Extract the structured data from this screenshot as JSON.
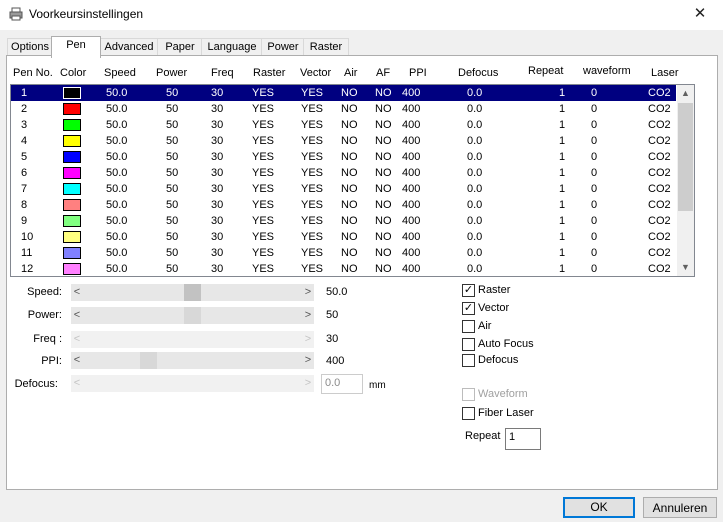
{
  "window": {
    "title": "Voorkeursinstellingen",
    "close_glyph": "✕"
  },
  "tabs": [
    "Options",
    "Pen",
    "Advanced",
    "Paper",
    "Language",
    "Power",
    "Raster"
  ],
  "active_tab": "Pen",
  "columns": [
    "Pen No.",
    "Color",
    "Speed",
    "Power",
    "Freq",
    "Raster",
    "Vector",
    "Air",
    "AF",
    "PPI",
    "Defocus",
    "Repeat",
    "waveform",
    "Laser"
  ],
  "pens": [
    {
      "no": "1",
      "color": "#000000",
      "speed": "50.0",
      "power": "50",
      "freq": "30",
      "raster": "YES",
      "vector": "YES",
      "air": "NO",
      "af": "NO",
      "ppi": "400",
      "defocus": "0.0",
      "repeat": "1",
      "waveform": "0",
      "laser": "CO2"
    },
    {
      "no": "2",
      "color": "#ff0000",
      "speed": "50.0",
      "power": "50",
      "freq": "30",
      "raster": "YES",
      "vector": "YES",
      "air": "NO",
      "af": "NO",
      "ppi": "400",
      "defocus": "0.0",
      "repeat": "1",
      "waveform": "0",
      "laser": "CO2"
    },
    {
      "no": "3",
      "color": "#00ff00",
      "speed": "50.0",
      "power": "50",
      "freq": "30",
      "raster": "YES",
      "vector": "YES",
      "air": "NO",
      "af": "NO",
      "ppi": "400",
      "defocus": "0.0",
      "repeat": "1",
      "waveform": "0",
      "laser": "CO2"
    },
    {
      "no": "4",
      "color": "#ffff00",
      "speed": "50.0",
      "power": "50",
      "freq": "30",
      "raster": "YES",
      "vector": "YES",
      "air": "NO",
      "af": "NO",
      "ppi": "400",
      "defocus": "0.0",
      "repeat": "1",
      "waveform": "0",
      "laser": "CO2"
    },
    {
      "no": "5",
      "color": "#0000ff",
      "speed": "50.0",
      "power": "50",
      "freq": "30",
      "raster": "YES",
      "vector": "YES",
      "air": "NO",
      "af": "NO",
      "ppi": "400",
      "defocus": "0.0",
      "repeat": "1",
      "waveform": "0",
      "laser": "CO2"
    },
    {
      "no": "6",
      "color": "#ff00ff",
      "speed": "50.0",
      "power": "50",
      "freq": "30",
      "raster": "YES",
      "vector": "YES",
      "air": "NO",
      "af": "NO",
      "ppi": "400",
      "defocus": "0.0",
      "repeat": "1",
      "waveform": "0",
      "laser": "CO2"
    },
    {
      "no": "7",
      "color": "#00ffff",
      "speed": "50.0",
      "power": "50",
      "freq": "30",
      "raster": "YES",
      "vector": "YES",
      "air": "NO",
      "af": "NO",
      "ppi": "400",
      "defocus": "0.0",
      "repeat": "1",
      "waveform": "0",
      "laser": "CO2"
    },
    {
      "no": "8",
      "color": "#ff8080",
      "speed": "50.0",
      "power": "50",
      "freq": "30",
      "raster": "YES",
      "vector": "YES",
      "air": "NO",
      "af": "NO",
      "ppi": "400",
      "defocus": "0.0",
      "repeat": "1",
      "waveform": "0",
      "laser": "CO2"
    },
    {
      "no": "9",
      "color": "#80ff80",
      "speed": "50.0",
      "power": "50",
      "freq": "30",
      "raster": "YES",
      "vector": "YES",
      "air": "NO",
      "af": "NO",
      "ppi": "400",
      "defocus": "0.0",
      "repeat": "1",
      "waveform": "0",
      "laser": "CO2"
    },
    {
      "no": "10",
      "color": "#ffff80",
      "speed": "50.0",
      "power": "50",
      "freq": "30",
      "raster": "YES",
      "vector": "YES",
      "air": "NO",
      "af": "NO",
      "ppi": "400",
      "defocus": "0.0",
      "repeat": "1",
      "waveform": "0",
      "laser": "CO2"
    },
    {
      "no": "11",
      "color": "#8080ff",
      "speed": "50.0",
      "power": "50",
      "freq": "30",
      "raster": "YES",
      "vector": "YES",
      "air": "NO",
      "af": "NO",
      "ppi": "400",
      "defocus": "0.0",
      "repeat": "1",
      "waveform": "0",
      "laser": "CO2"
    },
    {
      "no": "12",
      "color": "#ff80ff",
      "speed": "50.0",
      "power": "50",
      "freq": "30",
      "raster": "YES",
      "vector": "YES",
      "air": "NO",
      "af": "NO",
      "ppi": "400",
      "defocus": "0.0",
      "repeat": "1",
      "waveform": "0",
      "laser": "CO2"
    }
  ],
  "selected_pen": "1",
  "params": {
    "speed": {
      "label": "Speed:",
      "value": "50.0",
      "level": 0.5
    },
    "power": {
      "label": "Power:",
      "value": "50",
      "level": 0.5
    },
    "freq": {
      "label": "Freq :",
      "value": "30"
    },
    "ppi": {
      "label": "PPI:",
      "value": "400",
      "level": 0.28
    },
    "defocus": {
      "label": "Defocus:",
      "value": "0.0",
      "unit": "mm"
    }
  },
  "checkboxes": {
    "raster": {
      "label": "Raster",
      "checked": true
    },
    "vector": {
      "label": "Vector",
      "checked": true
    },
    "air": {
      "label": "Air",
      "checked": false
    },
    "auto_focus": {
      "label": "Auto Focus",
      "checked": false
    },
    "defocus": {
      "label": "Defocus",
      "checked": false
    },
    "waveform": {
      "label": "Waveform",
      "checked": false,
      "disabled": true
    },
    "fiber_laser": {
      "label": "Fiber Laser",
      "checked": false
    }
  },
  "repeat": {
    "label": "Repeat",
    "value": "1"
  },
  "buttons": {
    "ok": "OK",
    "cancel": "Annuleren"
  },
  "colors": {
    "selection": "#000080",
    "default_button_border": "#0078d7"
  }
}
